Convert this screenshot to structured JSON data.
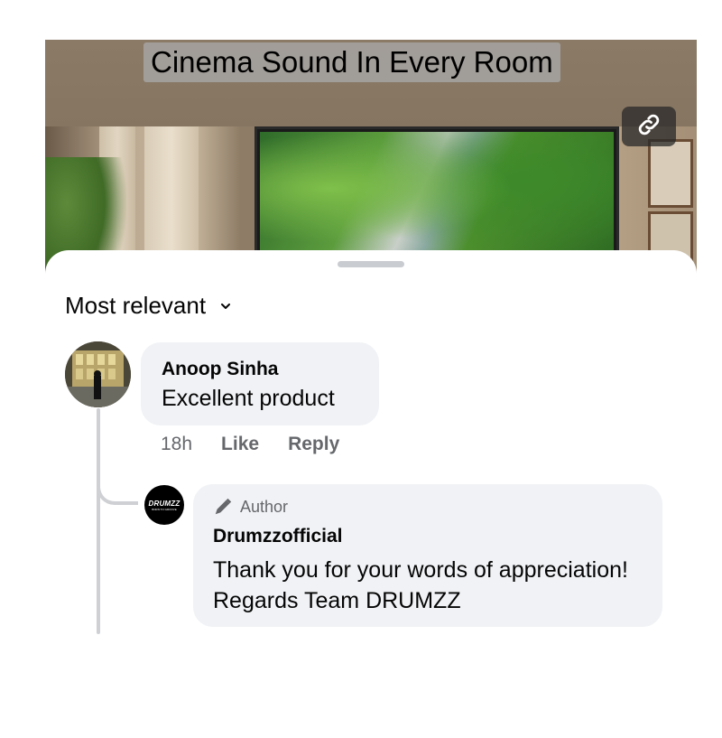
{
  "video": {
    "title": "Cinema Sound In Every Room",
    "link_icon": "link-icon"
  },
  "comments_sheet": {
    "sort_label": "Most relevant",
    "sort_icon": "chevron-down-icon"
  },
  "comments": [
    {
      "author": "Anoop Sinha",
      "text": "Excellent product",
      "time": "18h",
      "like_label": "Like",
      "reply_label": "Reply"
    }
  ],
  "replies": [
    {
      "badge": "Author",
      "badge_icon": "pen-icon",
      "author": "Drumzzofficial",
      "avatar_logo": "DRUMZZ",
      "avatar_tagline": "BORN TO GROOVE",
      "text": "Thank you for your words of appreciation! Regards Team DRUMZZ"
    }
  ],
  "colors": {
    "bubble_bg": "#f0f2f5",
    "secondary_text": "#65676b",
    "thread_line": "#ced0d4"
  }
}
